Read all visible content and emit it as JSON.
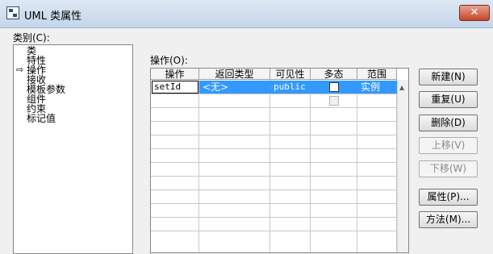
{
  "window": {
    "title": "UML 类属性",
    "close": "✕"
  },
  "categories": {
    "label": "类别(C):",
    "items": [
      "类",
      "特性",
      "操作",
      "接收",
      "模板参数",
      "组件",
      "约束",
      "标记值"
    ],
    "selected_marker": "⇨"
  },
  "operations": {
    "label": "操作(O):",
    "columns": [
      "操作",
      "返回类型",
      "可见性",
      "多态",
      "范围"
    ],
    "rows": [
      {
        "name": "setId",
        "return_type": "<无>",
        "visibility": "public",
        "polymorphic": false,
        "scope": "实例"
      }
    ]
  },
  "buttons": {
    "new": "新建(N)",
    "duplicate": "重复(U)",
    "delete": "删除(D)",
    "move_up": "上移(V)",
    "move_down": "下移(W)",
    "properties": "属性(P)...",
    "methods": "方法(M)..."
  },
  "colors": {
    "selection": "#3399ff",
    "title_gradient": "#c4d6ea",
    "close": "#c7442a"
  }
}
